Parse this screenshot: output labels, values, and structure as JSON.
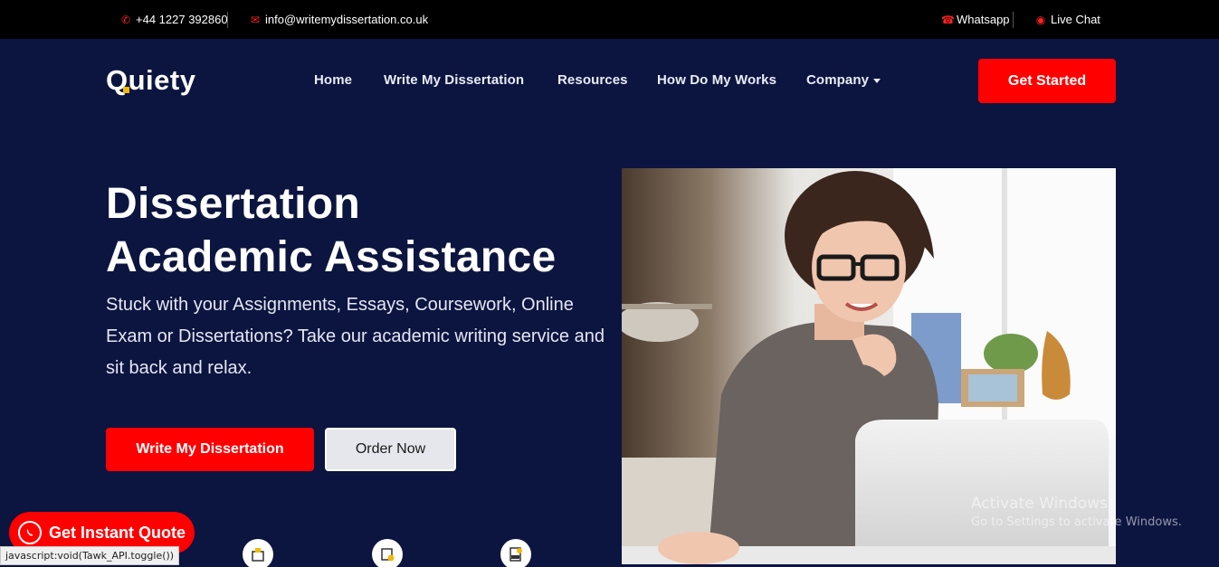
{
  "topbar": {
    "phone": "+44 1227 392860",
    "email": "info@writemydissertation.co.uk",
    "whatsapp": "Whatsapp",
    "live_chat": "Live Chat"
  },
  "brand": {
    "logo_rest": "uiety",
    "logo_first": "Q"
  },
  "nav": {
    "items": [
      {
        "label": "Home"
      },
      {
        "label": "Write My Dissertation"
      },
      {
        "label": "Resources"
      },
      {
        "label": "How Do My Works"
      },
      {
        "label": "Company"
      }
    ],
    "cta": "Get Started"
  },
  "hero": {
    "title_line1": "Dissertation",
    "title_line2": "Academic Assistance",
    "subtitle": "Stuck with your Assignments, Essays, Coursework, Online Exam or Dissertations? Take our academic writing service and sit back and relax.",
    "primary_button": "Write My Dissertation",
    "secondary_button": "Order Now"
  },
  "floating": {
    "quote_button": "Get Instant Quote"
  },
  "status_bar": {
    "text": "javascript:void(Tawk_API.toggle())"
  },
  "watermark": {
    "title": "Activate Windows",
    "subtitle": "Go to Settings to activate Windows."
  },
  "colors": {
    "accent": "#ff0000",
    "background": "#0c1540",
    "topbar": "#000000"
  }
}
